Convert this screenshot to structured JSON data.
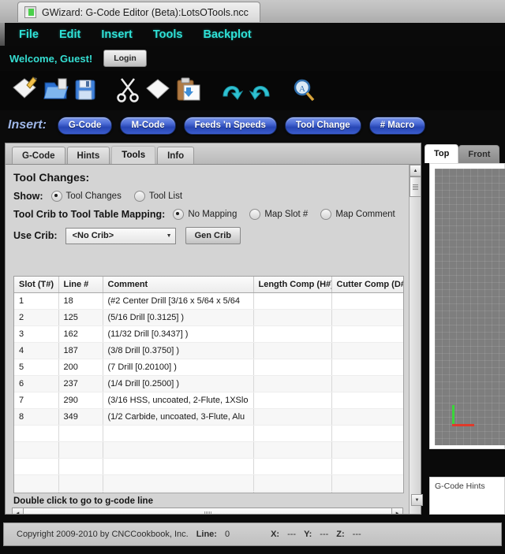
{
  "window": {
    "title": "GWizard: G-Code Editor (Beta):LotsOTools.ncc",
    "icon": "app-window-icon"
  },
  "menubar": {
    "items": [
      {
        "label": "File"
      },
      {
        "label": "Edit"
      },
      {
        "label": "Insert"
      },
      {
        "label": "Tools"
      },
      {
        "label": "Backplot"
      }
    ],
    "color": "#2fe3d8"
  },
  "welcome": {
    "text": "Welcome, Guest!",
    "login_label": "Login"
  },
  "toolbar": {
    "buttons": [
      {
        "name": "new-file-icon",
        "title": "New"
      },
      {
        "name": "open-folder-icon",
        "title": "Open"
      },
      {
        "name": "save-floppy-icon",
        "title": "Save"
      },
      {
        "name": "cut-scissors-icon",
        "title": "Cut"
      },
      {
        "name": "copy-icon",
        "title": "Copy"
      },
      {
        "name": "paste-clipboard-icon",
        "title": "Paste"
      },
      {
        "name": "undo-arrow-icon",
        "title": "Undo"
      },
      {
        "name": "redo-arrow-icon",
        "title": "Redo"
      },
      {
        "name": "find-magnifier-icon",
        "title": "Find"
      }
    ]
  },
  "insert_bar": {
    "label": "Insert:",
    "buttons": [
      {
        "label": "G-Code"
      },
      {
        "label": "M-Code"
      },
      {
        "label": "Feeds 'n Speeds"
      },
      {
        "label": "Tool Change"
      },
      {
        "label": "# Macro"
      }
    ],
    "accent": "#3b5ccd"
  },
  "left_panel": {
    "tabs": [
      {
        "label": "G-Code",
        "active": false
      },
      {
        "label": "Hints",
        "active": false
      },
      {
        "label": "Tools",
        "active": true
      },
      {
        "label": "Info",
        "active": false
      }
    ],
    "heading": "Tool Changes:",
    "show": {
      "label": "Show:",
      "options": [
        {
          "label": "Tool Changes",
          "selected": true
        },
        {
          "label": "Tool List",
          "selected": false
        }
      ]
    },
    "mapping": {
      "label": "Tool Crib to Tool Table Mapping:",
      "options": [
        {
          "label": "No Mapping",
          "selected": true
        },
        {
          "label": "Map Slot #",
          "selected": false
        },
        {
          "label": "Map Comment",
          "selected": false
        }
      ]
    },
    "crib": {
      "label": "Use Crib:",
      "value": "<No Crib>",
      "gen_label": "Gen Crib"
    },
    "table": {
      "columns": [
        "Slot (T#)",
        "Line #",
        "Comment",
        "Length Comp (H#)",
        "Cutter Comp (D#)"
      ],
      "rows": [
        {
          "slot": "1",
          "line": "18",
          "comment": "(#2 Center Drill [3/16 x 5/64 x 5/64",
          "length": "",
          "cutter": ""
        },
        {
          "slot": "2",
          "line": "125",
          "comment": "(5/16 Drill [0.3125] )",
          "length": "",
          "cutter": ""
        },
        {
          "slot": "3",
          "line": "162",
          "comment": "(11/32 Drill [0.3437] )",
          "length": "",
          "cutter": ""
        },
        {
          "slot": "4",
          "line": "187",
          "comment": "(3/8 Drill [0.3750] )",
          "length": "",
          "cutter": ""
        },
        {
          "slot": "5",
          "line": "200",
          "comment": "(7 Drill [0.20100] )",
          "length": "",
          "cutter": ""
        },
        {
          "slot": "6",
          "line": "237",
          "comment": "(1/4  Drill [0.2500] )",
          "length": "",
          "cutter": ""
        },
        {
          "slot": "7",
          "line": "290",
          "comment": "(3/16 HSS, uncoated, 2-Flute, 1XSlo",
          "length": "",
          "cutter": ""
        },
        {
          "slot": "8",
          "line": "349",
          "comment": "(1/2 Carbide, uncoated, 3-Flute, Alu",
          "length": "",
          "cutter": ""
        },
        {
          "slot": "",
          "line": "",
          "comment": "",
          "length": "",
          "cutter": ""
        },
        {
          "slot": "",
          "line": "",
          "comment": "",
          "length": "",
          "cutter": ""
        },
        {
          "slot": "",
          "line": "",
          "comment": "",
          "length": "",
          "cutter": ""
        },
        {
          "slot": "",
          "line": "",
          "comment": "",
          "length": "",
          "cutter": ""
        },
        {
          "slot": "",
          "line": "",
          "comment": "",
          "length": "",
          "cutter": ""
        },
        {
          "slot": "",
          "line": "",
          "comment": "",
          "length": "",
          "cutter": ""
        }
      ]
    },
    "footer_note": "Double click to go to g-code line"
  },
  "right_panel": {
    "tabs": [
      {
        "label": "Top",
        "active": true
      },
      {
        "label": "Front",
        "active": false
      }
    ],
    "hints_title": "G-Code Hints",
    "axes": {
      "x_color": "#e03a2b",
      "y_color": "#3ad63a"
    }
  },
  "statusbar": {
    "copyright": "Copyright 2009-2010 by CNCCookbook, Inc.",
    "line_label": "Line:",
    "line_value": "0",
    "x_label": "X:",
    "x_value": "---",
    "y_label": "Y:",
    "y_value": "---",
    "z_label": "Z:",
    "z_value": "---"
  }
}
